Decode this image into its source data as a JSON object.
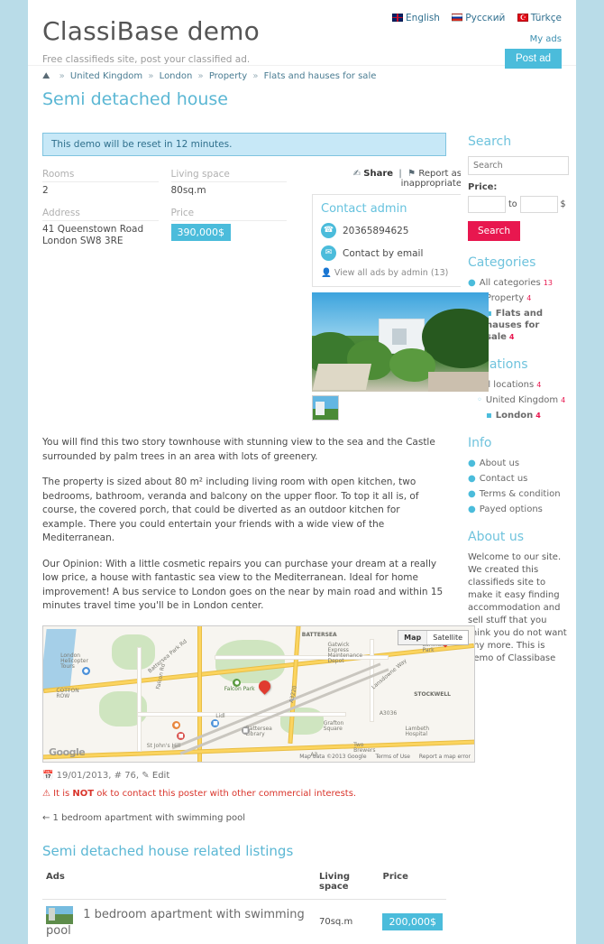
{
  "header": {
    "brand": "ClassiBase demo",
    "tagline": "Free classifieds site, post your classified ad.",
    "languages": [
      {
        "label": "English",
        "flag": "uk-flag-icon"
      },
      {
        "label": "Русский",
        "flag": "russia-flag-icon"
      },
      {
        "label": "Türkçe",
        "flag": "turkey-flag-icon"
      }
    ],
    "my_ads": "My ads",
    "post_ad": "Post ad",
    "accent": "#4bbcdb"
  },
  "breadcrumb": {
    "home_icon": "home-icon",
    "items": [
      "United Kingdom",
      "London",
      "Property",
      "Flats and hauses for sale"
    ],
    "separator": "»"
  },
  "listing": {
    "title": "Semi detached house",
    "alert": "This demo will be reset in 12 minutes.",
    "fields": [
      {
        "label": "Rooms",
        "value": "2"
      },
      {
        "label": "Living space",
        "value": "80sq.m"
      },
      {
        "label": "Address",
        "value": "41 Queenstown Road\nLondon SW8 3RE"
      },
      {
        "label": "Price",
        "value": "390,000$",
        "badge": true
      }
    ],
    "share": "Share",
    "report": "Report as inappropriate",
    "description": [
      "You will find this two story townhouse with stunning view to the sea and the Castle surrounded by palm trees in an area with lots of greenery.",
      "The property is sized about 80 m² including living room with open kitchen, two bedrooms, bathroom, veranda and balcony on the upper floor. To top it all is, of course, the covered porch, that could be diverted as an outdoor kitchen for example. There you could entertain your friends with a wide view of the Mediterranean.",
      "Our Opinion: With a little cosmetic repairs you can purchase your dream at a really low price, a house with fantastic sea view to the Mediterranean. Ideal for home improvement! A bus service to London goes on the near by main road and within 15 minutes travel time you'll be in London center."
    ],
    "meta": "19/01/2013, # 76,",
    "edit": "Edit",
    "warning_pre": "It is ",
    "warning_bold": "NOT",
    "warning_post": " ok to contact this poster with other commercial interests.",
    "prev_link": "← 1 bedroom apartment with swimming pool",
    "price_badge_color": "#4bbcdb"
  },
  "contact": {
    "title": "Contact admin",
    "phone": "20365894625",
    "phone_icon": "phone-icon",
    "email_label": "Contact by email",
    "email_icon": "envelope-icon",
    "view_all": "View all ads by admin (13)",
    "user_icon": "user-icon"
  },
  "map": {
    "controls": [
      "Map",
      "Satellite"
    ],
    "selected": "Map",
    "logo": "Google",
    "attribution": "Map data ©2013 Google",
    "terms": "Terms of Use",
    "report": "Report a map error",
    "labels": [
      "BATTERSEA",
      "London Helicopter Tours",
      "Battersea Park Rd",
      "Falcon Park",
      "COTTON ROW",
      "Falcon Rd",
      "Lidl",
      "A3220",
      "A3036",
      "Battersea Library",
      "St John's Hill",
      "Grafton Square",
      "STOCKWELL",
      "Lambeth Hospital",
      "Larkhall Park",
      "Gatwick Express Maintenance Depot",
      "Lansdowne Way",
      "Two Brewers",
      "A3",
      "A3036"
    ],
    "marker_icon": "map-pin-icon"
  },
  "related": {
    "heading": "Semi detached house related listings",
    "columns": [
      "Ads",
      "Living space",
      "Price"
    ],
    "rows": [
      {
        "title": "1 bedroom apartment with swimming pool",
        "living_space": "70sq.m",
        "price": "200,000$"
      }
    ]
  },
  "sidebar": {
    "search": {
      "heading": "Search",
      "placeholder": "Search",
      "value": "",
      "price_label": "Price:",
      "price_from": "",
      "price_to": "",
      "to_label": "to",
      "currency": "$",
      "button": "Search",
      "button_color": "#e8174f"
    },
    "categories": {
      "heading": "Categories",
      "items": [
        {
          "label": "All categories",
          "count": "13",
          "level": 1
        },
        {
          "label": "Property",
          "count": "4",
          "level": 2
        },
        {
          "label": "Flats and hauses for sale",
          "count": "4",
          "level": 3
        }
      ]
    },
    "locations": {
      "heading": "Locations",
      "items": [
        {
          "label": "All locations",
          "count": "4",
          "level": 1
        },
        {
          "label": "United Kingdom",
          "count": "4",
          "level": 2
        },
        {
          "label": "London",
          "count": "4",
          "level": 3
        }
      ]
    },
    "info": {
      "heading": "Info",
      "items": [
        "About us",
        "Contact us",
        "Terms & condition",
        "Payed options"
      ]
    },
    "about": {
      "heading": "About us",
      "text": "Welcome to our site. We created this classifieds site to make it easy finding accommodation and sell stuff that you think you do not want any more. This is demo of Classibase"
    }
  }
}
